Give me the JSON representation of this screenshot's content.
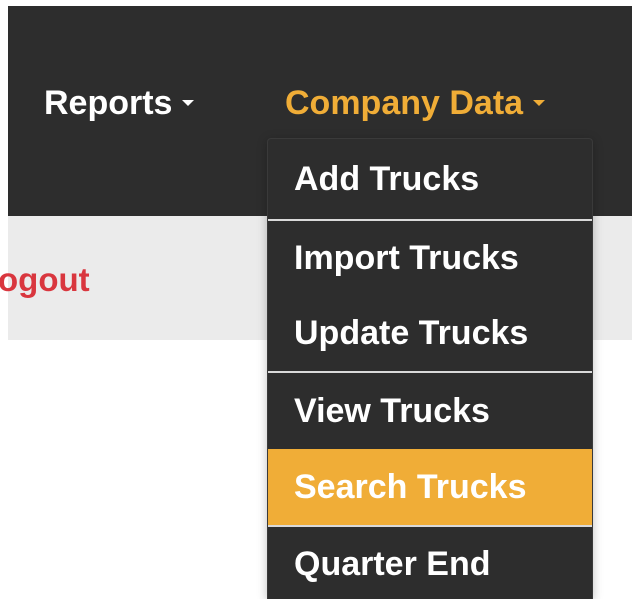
{
  "navbar": {
    "reports_label": "Reports",
    "company_data_label": "Company Data",
    "active_color": "#f0ad37"
  },
  "subbar": {
    "logout_label": "ogout"
  },
  "dropdown": {
    "items": [
      {
        "label": "Add Trucks"
      },
      {
        "label": "Import Trucks"
      },
      {
        "label": "Update Trucks"
      },
      {
        "label": "View Trucks"
      },
      {
        "label": "Search Trucks",
        "highlighted": true
      },
      {
        "label": "Quarter End"
      }
    ]
  }
}
